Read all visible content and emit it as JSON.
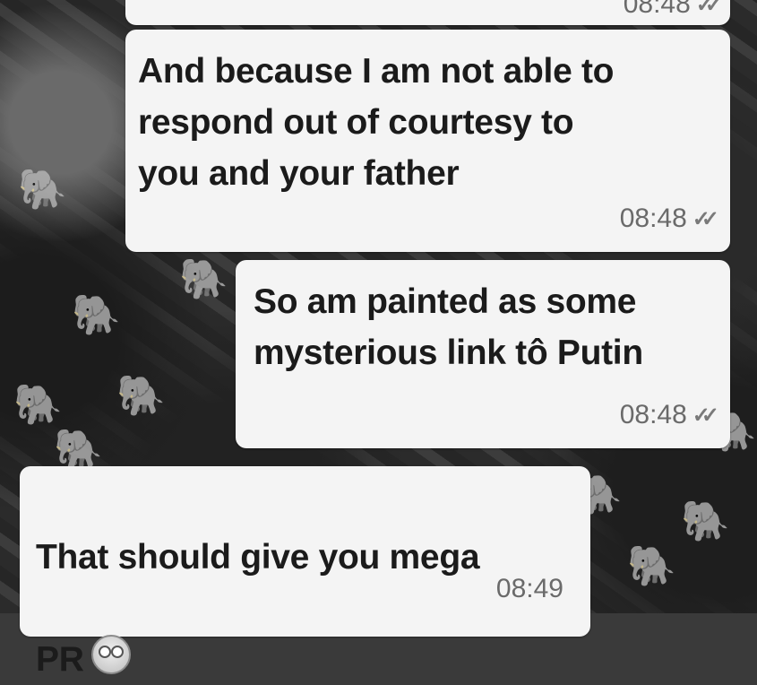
{
  "messages": [
    {
      "id": "prev",
      "time": "08:48",
      "ticks": "✓✓"
    },
    {
      "id": "m1",
      "text": "And because I am not able to\nrespond out of courtesy to\nyou and your father",
      "time": "08:48",
      "ticks": "✓✓"
    },
    {
      "id": "m2",
      "text": "So am painted as some\nmysterious link tô Putin",
      "time": "08:48",
      "ticks": "✓✓"
    },
    {
      "id": "m3",
      "text_line1": "That should give you mega",
      "text_line2": "PR",
      "emoji": "flushed-face-emoji",
      "time": "08:49"
    }
  ],
  "colors": {
    "bubble": "#f4f4f4",
    "text": "#1b1b1b",
    "meta": "#6a6a6a"
  }
}
